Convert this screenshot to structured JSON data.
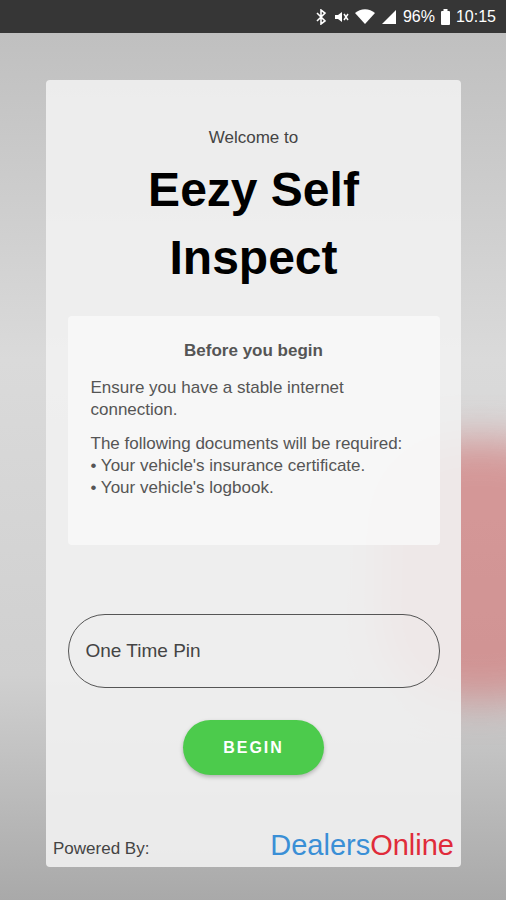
{
  "status_bar": {
    "battery": "96%",
    "time": "10:15"
  },
  "welcome": "Welcome to",
  "title_lines": [
    "Eezy Self",
    "Inspect"
  ],
  "notice": {
    "heading": "Before you begin",
    "paragraphs": [
      "Ensure you have a stable internet connection.",
      "The following documents will be required:"
    ],
    "list": [
      "• Your vehicle's insurance certificate.",
      "• Your vehicle's logbook."
    ]
  },
  "otp": {
    "placeholder": "One Time Pin"
  },
  "button": "BEGIN",
  "footer": {
    "label": "Powered By:",
    "brand": [
      {
        "text": "Dealers",
        "color": "#3a8fd6"
      },
      {
        "text": "Online",
        "color": "#e02b3a"
      }
    ]
  }
}
